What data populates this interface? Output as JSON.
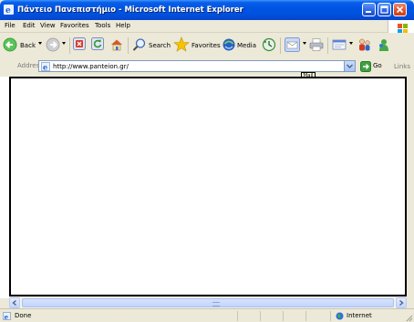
{
  "window": {
    "title": "Πάντειο Πανεπιστήμιο - Microsoft Internet Explorer"
  },
  "menu": {
    "items": [
      {
        "label": "File"
      },
      {
        "label": "Edit"
      },
      {
        "label": "View"
      },
      {
        "label": "Favorites"
      },
      {
        "label": "Tools"
      },
      {
        "label": "Help"
      }
    ]
  },
  "toolbar": {
    "back_label": "Back",
    "search_label": "Search",
    "favorites_label": "Favorites",
    "media_label": "Media",
    "mail_tooltip": "Mail"
  },
  "address": {
    "label": "Address",
    "url": "http://www.panteion.gr/",
    "go_label": "Go",
    "links_label": "Links"
  },
  "status": {
    "text": "Done",
    "zone": "Internet"
  },
  "colors": {
    "titlebar": "#0054e3",
    "chrome": "#ece9d8"
  }
}
